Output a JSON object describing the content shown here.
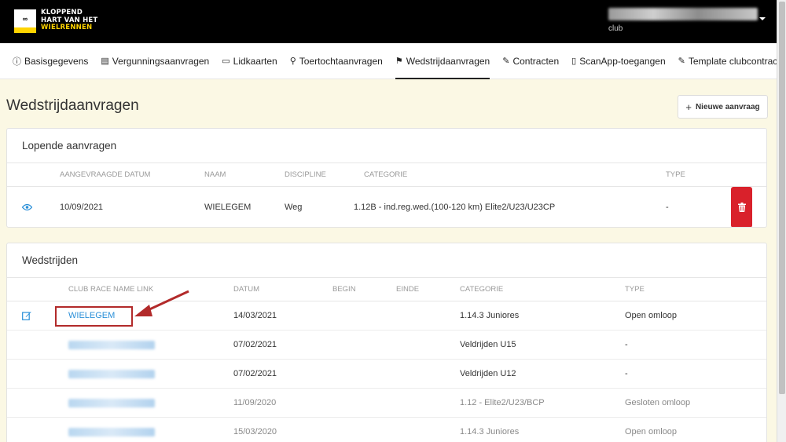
{
  "brand": {
    "badge": "CYCLING",
    "line1": "KLOPPEND",
    "line2": "HART VAN HET",
    "line3": "WIELRENNEN"
  },
  "user": {
    "role": "club"
  },
  "nav": [
    {
      "icon": "ⓘ",
      "label": "Basisgegevens",
      "icon_name": "info-icon"
    },
    {
      "icon": "▤",
      "label": "Vergunningsaanvragen",
      "icon_name": "license-icon"
    },
    {
      "icon": "▭",
      "label": "Lidkaarten",
      "icon_name": "card-icon"
    },
    {
      "icon": "⚲",
      "label": "Toertochtaanvragen",
      "icon_name": "bicycle-icon"
    },
    {
      "icon": "⚑",
      "label": "Wedstrijdaanvragen",
      "icon_name": "checkered-flag-icon",
      "active": true
    },
    {
      "icon": "✎",
      "label": "Contracten",
      "icon_name": "signature-icon"
    },
    {
      "icon": "▯",
      "label": "ScanApp-toegangen",
      "icon_name": "mobile-icon"
    },
    {
      "icon": "✎",
      "label": "Template clubcontract",
      "icon_name": "signature-icon"
    }
  ],
  "page": {
    "title": "Wedstrijdaanvragen",
    "new_button": "Nieuwe aanvraag"
  },
  "lopende": {
    "title": "Lopende aanvragen",
    "headers": [
      "AANGEVRAAGDE DATUM",
      "NAAM",
      "DISCIPLINE",
      "CATEGORIE",
      "TYPE"
    ],
    "rows": [
      {
        "datum": "10/09/2021",
        "naam": "WIELEGEM",
        "discipline": "Weg",
        "categorie": "1.12B - ind.reg.wed.(100-120 km) Elite2/U23/U23CP",
        "type": "-"
      }
    ]
  },
  "wedstrijden": {
    "title": "Wedstrijden",
    "headers": [
      "CLUB RACE NAME LINK",
      "DATUM",
      "BEGIN",
      "EINDE",
      "CATEGORIE",
      "TYPE"
    ],
    "rows": [
      {
        "name": "WIELEGEM",
        "datum": "14/03/2021",
        "begin": "",
        "einde": "",
        "categorie": "1.14.3 Juniores",
        "type": "Open omloop"
      },
      {
        "name": "",
        "datum": "07/02/2021",
        "begin": "",
        "einde": "",
        "categorie": "Veldrijden U15",
        "type": "-"
      },
      {
        "name": "",
        "datum": "07/02/2021",
        "begin": "",
        "einde": "",
        "categorie": "Veldrijden U12",
        "type": "-"
      },
      {
        "name": "",
        "datum": "11/09/2020",
        "begin": "",
        "einde": "",
        "categorie": "1.12 - Elite2/U23/BCP",
        "type": "Gesloten omloop"
      },
      {
        "name": "",
        "datum": "15/03/2020",
        "begin": "",
        "einde": "",
        "categorie": "1.14.3 Juniores",
        "type": "Open omloop"
      }
    ]
  },
  "colors": {
    "accent": "#2a8fd8",
    "danger": "#d9212b",
    "highlight": "#b22a2a",
    "background": "#fbf8e4"
  }
}
